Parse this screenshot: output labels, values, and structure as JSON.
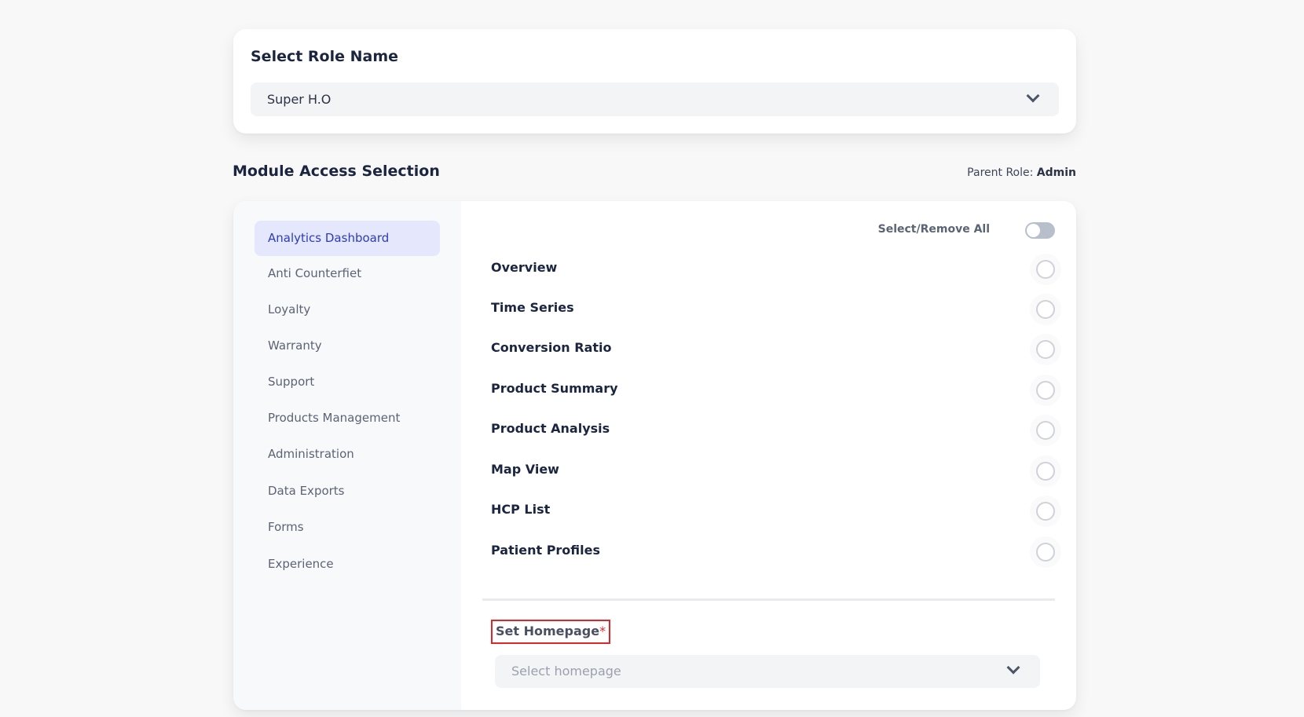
{
  "role": {
    "title": "Select Role Name",
    "selected": "Super H.O",
    "chevron_icon": "chevron-down-icon"
  },
  "module_access": {
    "title": "Module Access Selection",
    "parent_role_label": "Parent Role:",
    "parent_role_value": "Admin"
  },
  "sidebar": {
    "items": [
      {
        "label": "Analytics Dashboard",
        "active": true
      },
      {
        "label": "Anti Counterfiet"
      },
      {
        "label": "Loyalty"
      },
      {
        "label": "Warranty"
      },
      {
        "label": "Support"
      },
      {
        "label": "Products Management"
      },
      {
        "label": "Administration"
      },
      {
        "label": "Data Exports"
      },
      {
        "label": "Forms"
      },
      {
        "label": "Experience"
      }
    ]
  },
  "permissions": {
    "select_all_label": "Select/Remove All",
    "select_all_on": false,
    "items": [
      {
        "label": "Overview",
        "checked": false
      },
      {
        "label": "Time Series",
        "checked": false
      },
      {
        "label": "Conversion Ratio",
        "checked": false
      },
      {
        "label": "Product Summary",
        "checked": false
      },
      {
        "label": "Product Analysis",
        "checked": false
      },
      {
        "label": "Map View",
        "checked": false
      },
      {
        "label": "HCP List",
        "checked": false
      },
      {
        "label": "Patient Profiles",
        "checked": false
      }
    ]
  },
  "homepage": {
    "label": "Set Homepage",
    "required_marker": "*",
    "placeholder": "Select homepage"
  },
  "colors": {
    "active_bg": "#e5e8fd",
    "active_text": "#2b3ac2",
    "required_red": "#e0262b"
  }
}
